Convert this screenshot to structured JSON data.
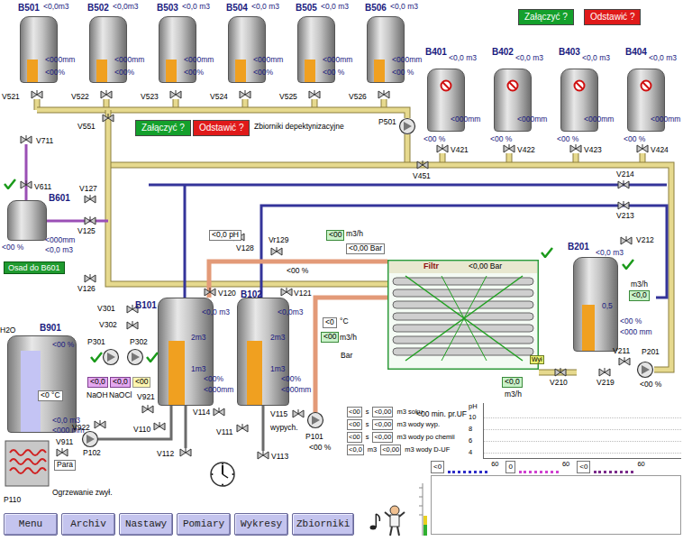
{
  "tanks": [
    {
      "id": "B501",
      "volume": "<0,0m3",
      "height": "<000mm",
      "percent": "<00%",
      "level": 0.35,
      "color": "#f0a020",
      "scale": [],
      "blocked": false,
      "checked": false
    },
    {
      "id": "B502",
      "volume": "<0,0m3",
      "height": "<000mm",
      "percent": "<00%",
      "level": 0.35,
      "color": "#f0a020",
      "scale": [],
      "blocked": false,
      "checked": false
    },
    {
      "id": "B503",
      "volume": "<0,0 m3",
      "height": "<000mm",
      "percent": "<00%",
      "level": 0.35,
      "color": "#f0a020",
      "scale": [],
      "blocked": false,
      "checked": false
    },
    {
      "id": "B504",
      "volume": "<0,0 m3",
      "height": "<000mm",
      "percent": "<00%",
      "level": 0.35,
      "color": "#f0a020",
      "scale": [],
      "blocked": false,
      "checked": false
    },
    {
      "id": "B505",
      "volume": "<0,0 m3",
      "height": "<000mm",
      "percent": "<00 %",
      "level": 0.35,
      "color": "#f0a020",
      "scale": [],
      "blocked": false,
      "checked": false
    },
    {
      "id": "B506",
      "volume": "<0,0 m3",
      "height": "<000mm",
      "percent": "<00 %",
      "level": 0.35,
      "color": "#f0a020",
      "scale": [],
      "blocked": false,
      "checked": false
    },
    {
      "id": "B401",
      "volume": "<0,0 m3",
      "height": "<000mm",
      "percent": "<00 %",
      "level": 0,
      "color": "#f0a020",
      "scale": [],
      "blocked": true,
      "checked": false
    },
    {
      "id": "B402",
      "volume": "<0,0 m3",
      "height": "<000mm",
      "percent": "<00 %",
      "level": 0,
      "color": "#f0a020",
      "scale": [],
      "blocked": true,
      "checked": false
    },
    {
      "id": "B403",
      "volume": "<0,0 m3",
      "height": "<000mm",
      "percent": "<00 %",
      "level": 0,
      "color": "#f0a020",
      "scale": [],
      "blocked": true,
      "checked": false
    },
    {
      "id": "B404",
      "volume": "<0,0 m3",
      "height": "<000mm",
      "percent": "<00 %",
      "level": 0,
      "color": "#f0a020",
      "scale": [],
      "blocked": true,
      "checked": false
    },
    {
      "id": "B601",
      "volume": "<0,0 m3",
      "height": "<000mm",
      "percent": "<00 %",
      "level": 0,
      "color": "#f0a020",
      "scale": [],
      "blocked": false,
      "checked": true
    },
    {
      "id": "B201",
      "volume": "<0,0 m3",
      "height": "<000 mm",
      "percent": "<00 %",
      "level": 0.5,
      "color": "#f0a020",
      "scale": [
        "0,5"
      ],
      "blocked": false,
      "checked": true
    },
    {
      "id": "B901",
      "volume": "<0,0 m3",
      "height": "<000 mm",
      "percent": "<00 %",
      "level": 0.85,
      "color": "#c4c4f4",
      "scale": [],
      "blocked": false,
      "checked": false
    },
    {
      "id": "B101",
      "volume": "<0,0 m3",
      "height": "<000mm",
      "percent": "<00%",
      "level": 0.6,
      "color": "#f0a020",
      "scale": [
        "2m3",
        "1m3"
      ],
      "blocked": false,
      "checked": false
    },
    {
      "id": "B102",
      "volume": "<0,0m3",
      "height": "<000mm",
      "percent": "<00%",
      "level": 0.6,
      "color": "#f0a020",
      "scale": [
        "2m3",
        "1m3"
      ],
      "blocked": false,
      "checked": false
    }
  ],
  "valves": [
    "V521",
    "V522",
    "V523",
    "V524",
    "V525",
    "V526",
    "V551",
    "V421",
    "V422",
    "V423",
    "V424",
    "V451",
    "V214",
    "V213",
    "V212",
    "V211",
    "V219",
    "V210",
    "V711",
    "V611",
    "V127",
    "V125",
    "V126",
    "V911",
    "V301",
    "V302",
    "V921",
    "V922",
    "V110",
    "V114",
    "V112",
    "V120",
    "V128",
    "Vr129",
    "V121",
    "V115",
    "V111",
    "V113"
  ],
  "pumps": [
    {
      "label": "P501",
      "checked": false
    },
    {
      "label": "P101",
      "checked": false,
      "percent": "<00 %"
    },
    {
      "label": "P201",
      "checked": false,
      "percent": "<00 %"
    },
    {
      "label": "P102",
      "checked": false
    },
    {
      "label": "P301",
      "checked": true
    },
    {
      "label": "P302",
      "checked": true
    }
  ],
  "buttons": [
    {
      "label": "Załączyć ?",
      "kind": "start"
    },
    {
      "label": "Odstawić ?",
      "kind": "stop"
    },
    {
      "label": "Załączyć ?",
      "kind": "start"
    },
    {
      "label": "Odstawić ?",
      "kind": "stop"
    }
  ],
  "labels": [
    {
      "text": "Zbiorniki depektynizacyjne",
      "kind": "plain"
    },
    {
      "text": "Osad do B601",
      "kind": "greenbar"
    },
    {
      "text": "H2O",
      "kind": "plain"
    },
    {
      "text": "<0 °C",
      "kind": "box"
    },
    {
      "text": "Para",
      "kind": "box"
    },
    {
      "text": "P110",
      "kind": "plain"
    },
    {
      "text": "Ogrzewanie zwył.",
      "kind": "plain"
    },
    {
      "text": "<0,0",
      "kind": "purple"
    },
    {
      "text": "<0,0",
      "kind": "purple"
    },
    {
      "text": "<00",
      "kind": "yellow"
    },
    {
      "text": "NaOH",
      "kind": "plain"
    },
    {
      "text": "NaOCl",
      "kind": "plain"
    },
    {
      "text": "<0,0 pH",
      "kind": "box"
    },
    {
      "text": "<00",
      "kind": "green"
    },
    {
      "text": "m3/h",
      "kind": "plain"
    },
    {
      "text": "<0,00 Bar",
      "kind": "box"
    },
    {
      "text": "<00 %",
      "kind": "plain"
    },
    {
      "text": "<0",
      "kind": "box"
    },
    {
      "text": "°C",
      "kind": "plain"
    },
    {
      "text": "<00",
      "kind": "green"
    },
    {
      "text": "m3/h",
      "kind": "plain"
    },
    {
      "text": "Bar",
      "kind": "plain"
    },
    {
      "text": "m3/h",
      "kind": "plain"
    },
    {
      "text": "<0,0",
      "kind": "green"
    },
    {
      "text": "wypych.",
      "kind": "plain"
    },
    {
      "text": "<00 min. pr.UF",
      "kind": "plain"
    }
  ],
  "filter": {
    "title": "Filtr",
    "pressure": "<0,00 Bar",
    "checked": true,
    "flow": "<0,0",
    "flow_unit": "m3/h",
    "switch": "Wył"
  },
  "totals": [
    {
      "value": "<00",
      "unit": "s",
      "amount": "<0,00",
      "description": "m3 soku"
    },
    {
      "value": "<00",
      "unit": "s",
      "amount": "<0,00",
      "description": "m3 wody wyp."
    },
    {
      "value": "<00",
      "unit": "s",
      "amount": "<0,00",
      "description": "m3 wody po chemii"
    },
    {
      "value": "<0,0",
      "unit": "m3",
      "amount": "<0,00",
      "description": "m3 wody D-UF"
    }
  ],
  "chart": {
    "axis_label": "pH",
    "ticks": [
      "10",
      "8",
      "6",
      "4"
    ]
  },
  "gauges": [
    {
      "reading": "<0",
      "max": "60",
      "level": 0,
      "color": "#2d2dc8"
    },
    {
      "reading": "0",
      "max": "60",
      "level": 0,
      "color": "#d040d0"
    },
    {
      "reading": "<0",
      "max": "60",
      "level": 0,
      "color": "#7a2a8a"
    }
  ],
  "menu": [
    "Menu",
    "Archiv",
    "Nastawy",
    "Pomiary",
    "Wykresy",
    "Zbiorniki"
  ]
}
